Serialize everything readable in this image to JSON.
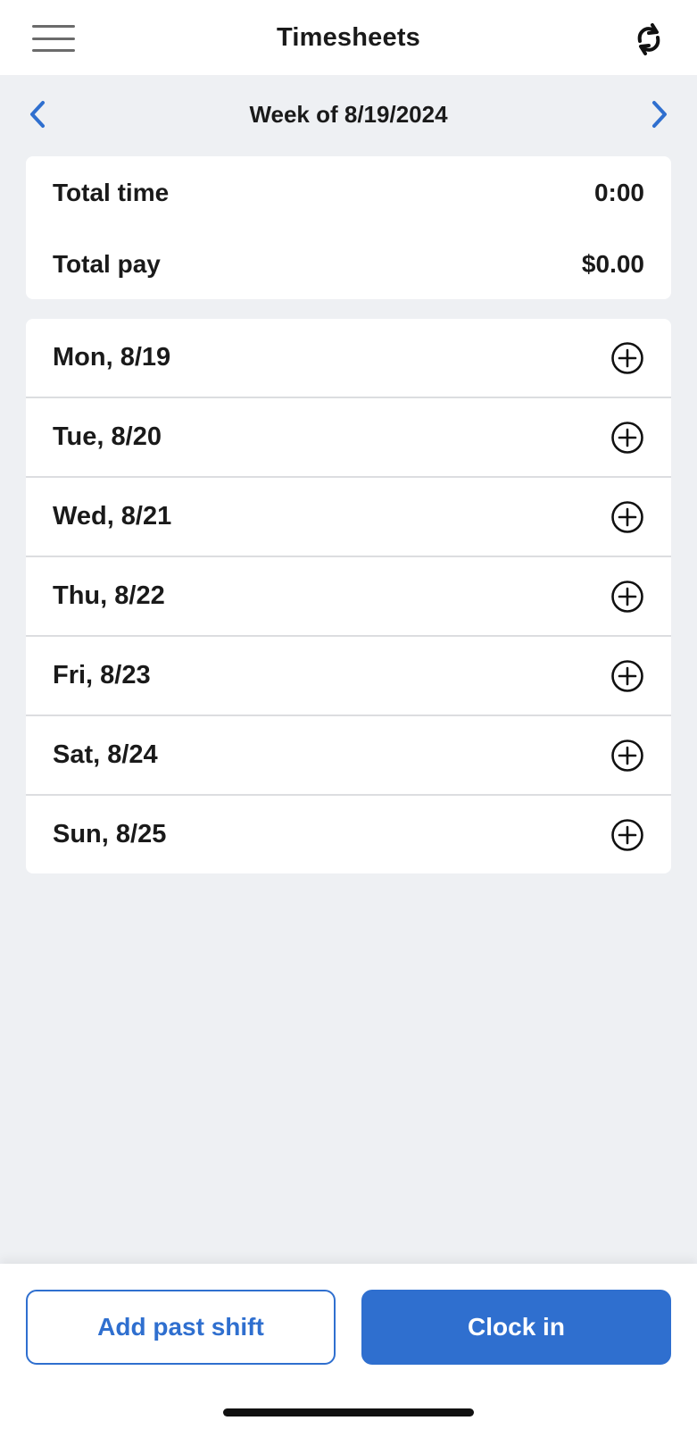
{
  "header": {
    "title": "Timesheets",
    "menu_icon": "hamburger-menu-icon",
    "refresh_icon": "refresh-icon"
  },
  "week_nav": {
    "label": "Week of 8/19/2024",
    "prev_icon": "chevron-left-icon",
    "next_icon": "chevron-right-icon"
  },
  "summary": {
    "total_time_label": "Total time",
    "total_time_value": "0:00",
    "total_pay_label": "Total pay",
    "total_pay_value": "$0.00"
  },
  "days": [
    {
      "label": "Mon, 8/19"
    },
    {
      "label": "Tue, 8/20"
    },
    {
      "label": "Wed, 8/21"
    },
    {
      "label": "Thu, 8/22"
    },
    {
      "label": "Fri, 8/23"
    },
    {
      "label": "Sat, 8/24"
    },
    {
      "label": "Sun, 8/25"
    }
  ],
  "footer": {
    "add_past_shift": "Add past shift",
    "clock_in": "Clock in"
  },
  "colors": {
    "accent": "#2f6fcf",
    "background": "#eef0f3",
    "card": "#ffffff",
    "text": "#1a1a1a"
  }
}
